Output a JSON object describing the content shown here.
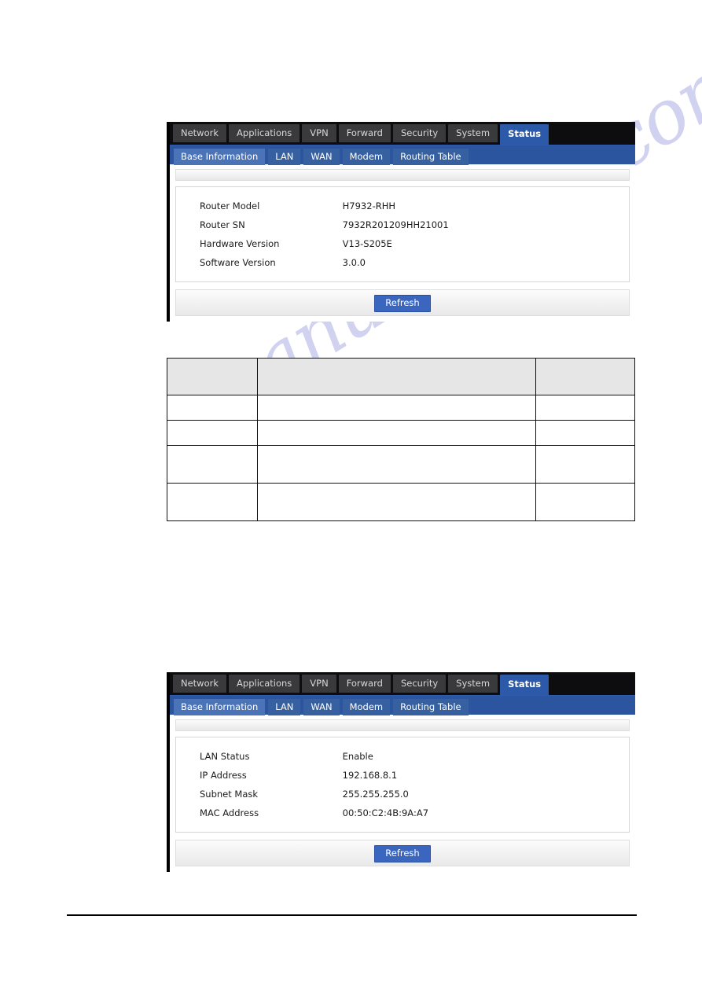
{
  "nav": {
    "main_tabs": [
      {
        "label": "Network",
        "active": false
      },
      {
        "label": "Applications",
        "active": false
      },
      {
        "label": "VPN",
        "active": false
      },
      {
        "label": "Forward",
        "active": false
      },
      {
        "label": "Security",
        "active": false
      },
      {
        "label": "System",
        "active": false
      },
      {
        "label": "Status",
        "active": true
      }
    ],
    "sub_tabs": [
      {
        "label": "Base Information",
        "active": true
      },
      {
        "label": "LAN",
        "active": false
      },
      {
        "label": "WAN",
        "active": false
      },
      {
        "label": "Modem",
        "active": false
      },
      {
        "label": "Routing Table",
        "active": false
      }
    ]
  },
  "panel_base_information": {
    "rows": [
      {
        "label": "Router Model",
        "value": "H7932-RHH"
      },
      {
        "label": "Router SN",
        "value": "7932R201209HH21001"
      },
      {
        "label": "Hardware Version",
        "value": "V13-S205E"
      },
      {
        "label": "Software Version",
        "value": "3.0.0"
      }
    ],
    "refresh_label": "Refresh"
  },
  "panel_lan": {
    "rows": [
      {
        "label": "LAN Status",
        "value": "Enable"
      },
      {
        "label": "IP Address",
        "value": "192.168.8.1"
      },
      {
        "label": "Subnet Mask",
        "value": "255.255.255.0"
      },
      {
        "label": "MAC Address",
        "value": "00:50:C2:4B:9A:A7"
      }
    ],
    "refresh_label": "Refresh"
  },
  "blank_table": {
    "header": [
      "",
      "",
      ""
    ],
    "rows": [
      [
        "",
        "",
        ""
      ],
      [
        "",
        "",
        ""
      ],
      [
        "",
        "",
        ""
      ],
      [
        "",
        "",
        ""
      ]
    ]
  },
  "watermark": {
    "text": "manualshive.com"
  },
  "colors": {
    "tabbar_background": "#0d0d0f",
    "tab_inactive": "#3a3a3c",
    "tab_active": "#2d5aa8",
    "subtabbar": "#2c55a0",
    "subtab_active": "#4a73b8",
    "button_blue": "#3a66c0",
    "table_header_grey": "#e6e6e6"
  }
}
